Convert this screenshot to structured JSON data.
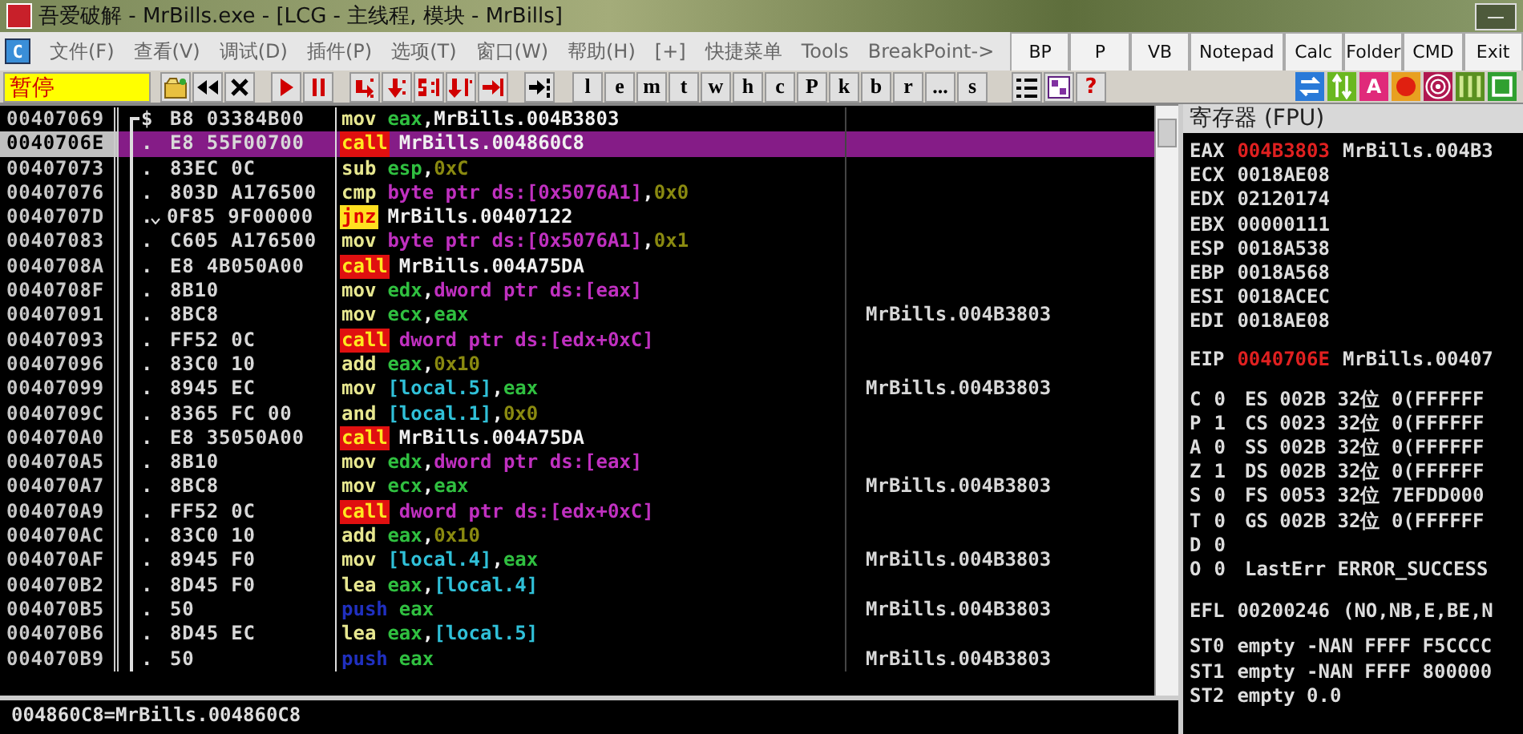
{
  "window": {
    "title": "吾爱破解 - MrBills.exe - [LCG -  主线程, 模块 - MrBills]",
    "minimize": "—"
  },
  "menu": {
    "logo": "C",
    "items": [
      "文件(F)",
      "查看(V)",
      "调试(D)",
      "插件(P)",
      "选项(T)",
      "窗口(W)",
      "帮助(H)",
      "[+]",
      "快捷菜单",
      "Tools",
      "BreakPoint->"
    ]
  },
  "plugin_buttons": [
    "BP",
    "P",
    "VB",
    "Notepad",
    "Calc",
    "Folder",
    "CMD",
    "Exit"
  ],
  "toolbar": {
    "status": "暂停",
    "letter_buttons": [
      "l",
      "e",
      "m",
      "t",
      "w",
      "h",
      "c",
      "P",
      "k",
      "b",
      "r",
      "...",
      "s"
    ],
    "help": "?",
    "badge_letter": "A"
  },
  "disassembly": {
    "rows": [
      {
        "address": "00407069",
        "marker": "$",
        "bracket_start": true,
        "jump": false,
        "hex": "B8 03384B00",
        "selected": false,
        "kind": "plain",
        "mnemonic": "mov",
        "operands": [
          {
            "text": "eax",
            "kind": "reg"
          },
          {
            "text": ",",
            "kind": "punct"
          },
          {
            "text": "MrBills.004B3803",
            "kind": "sym"
          }
        ]
      },
      {
        "address": "0040706E",
        "marker": ".",
        "bracket_start": false,
        "jump": false,
        "hex": "E8 55F00700",
        "selected": true,
        "kind": "call",
        "mnemonic": "call",
        "operands": [
          {
            "text": "MrBills.004860C8",
            "kind": "sym"
          }
        ]
      },
      {
        "address": "00407073",
        "marker": ".",
        "bracket_start": false,
        "jump": false,
        "hex": "83EC 0C",
        "selected": false,
        "kind": "plain",
        "mnemonic": "sub",
        "operands": [
          {
            "text": "esp",
            "kind": "reg"
          },
          {
            "text": ",",
            "kind": "punct"
          },
          {
            "text": "0xC",
            "kind": "num"
          }
        ]
      },
      {
        "address": "00407076",
        "marker": ".",
        "bracket_start": false,
        "jump": false,
        "hex": "803D A176500",
        "selected": false,
        "kind": "plain",
        "mnemonic": "cmp",
        "operands": [
          {
            "text": "byte ptr ds:[0x5076A1]",
            "kind": "mem"
          },
          {
            "text": ",",
            "kind": "punct"
          },
          {
            "text": "0x0",
            "kind": "num"
          }
        ]
      },
      {
        "address": "0040707D",
        "marker": ".",
        "bracket_start": false,
        "jump": true,
        "hex": "0F85 9F00000",
        "selected": false,
        "kind": "jump",
        "mnemonic": "jnz",
        "operands": [
          {
            "text": "MrBills.00407122",
            "kind": "sym"
          }
        ]
      },
      {
        "address": "00407083",
        "marker": ".",
        "bracket_start": false,
        "jump": false,
        "hex": "C605 A176500",
        "selected": false,
        "kind": "plain",
        "mnemonic": "mov",
        "operands": [
          {
            "text": "byte ptr ds:[0x5076A1]",
            "kind": "mem"
          },
          {
            "text": ",",
            "kind": "punct"
          },
          {
            "text": "0x1",
            "kind": "num"
          }
        ]
      },
      {
        "address": "0040708A",
        "marker": ".",
        "bracket_start": false,
        "jump": false,
        "hex": "E8 4B050A00",
        "selected": false,
        "kind": "call",
        "mnemonic": "call",
        "operands": [
          {
            "text": "MrBills.004A75DA",
            "kind": "sym"
          }
        ]
      },
      {
        "address": "0040708F",
        "marker": ".",
        "bracket_start": false,
        "jump": false,
        "hex": "8B10",
        "selected": false,
        "kind": "plain",
        "mnemonic": "mov",
        "operands": [
          {
            "text": "edx",
            "kind": "reg"
          },
          {
            "text": ",",
            "kind": "punct"
          },
          {
            "text": "dword ptr ds:[eax]",
            "kind": "mem"
          }
        ]
      },
      {
        "address": "00407091",
        "marker": ".",
        "bracket_start": false,
        "jump": false,
        "hex": "8BC8",
        "selected": false,
        "kind": "plain",
        "mnemonic": "mov",
        "operands": [
          {
            "text": "ecx",
            "kind": "reg"
          },
          {
            "text": ",",
            "kind": "punct"
          },
          {
            "text": "eax",
            "kind": "reg"
          }
        ],
        "comment": "MrBills.004B3803"
      },
      {
        "address": "00407093",
        "marker": ".",
        "bracket_start": false,
        "jump": false,
        "hex": "FF52 0C",
        "selected": false,
        "kind": "call",
        "mnemonic": "call",
        "operands": [
          {
            "text": "dword ptr ds:[edx+0xC]",
            "kind": "mem"
          }
        ]
      },
      {
        "address": "00407096",
        "marker": ".",
        "bracket_start": false,
        "jump": false,
        "hex": "83C0 10",
        "selected": false,
        "kind": "plain",
        "mnemonic": "add",
        "operands": [
          {
            "text": "eax",
            "kind": "reg"
          },
          {
            "text": ",",
            "kind": "punct"
          },
          {
            "text": "0x10",
            "kind": "num"
          }
        ]
      },
      {
        "address": "00407099",
        "marker": ".",
        "bracket_start": false,
        "jump": false,
        "hex": "8945 EC",
        "selected": false,
        "kind": "plain",
        "mnemonic": "mov",
        "operands": [
          {
            "text": "[local.5]",
            "kind": "local"
          },
          {
            "text": ",",
            "kind": "punct"
          },
          {
            "text": "eax",
            "kind": "reg"
          }
        ],
        "comment": "MrBills.004B3803"
      },
      {
        "address": "0040709C",
        "marker": ".",
        "bracket_start": false,
        "jump": false,
        "hex": "8365 FC 00",
        "selected": false,
        "kind": "plain",
        "mnemonic": "and",
        "operands": [
          {
            "text": "[local.1]",
            "kind": "local"
          },
          {
            "text": ",",
            "kind": "punct"
          },
          {
            "text": "0x0",
            "kind": "num"
          }
        ]
      },
      {
        "address": "004070A0",
        "marker": ".",
        "bracket_start": false,
        "jump": false,
        "hex": "E8 35050A00",
        "selected": false,
        "kind": "call",
        "mnemonic": "call",
        "operands": [
          {
            "text": "MrBills.004A75DA",
            "kind": "sym"
          }
        ]
      },
      {
        "address": "004070A5",
        "marker": ".",
        "bracket_start": false,
        "jump": false,
        "hex": "8B10",
        "selected": false,
        "kind": "plain",
        "mnemonic": "mov",
        "operands": [
          {
            "text": "edx",
            "kind": "reg"
          },
          {
            "text": ",",
            "kind": "punct"
          },
          {
            "text": "dword ptr ds:[eax]",
            "kind": "mem"
          }
        ]
      },
      {
        "address": "004070A7",
        "marker": ".",
        "bracket_start": false,
        "jump": false,
        "hex": "8BC8",
        "selected": false,
        "kind": "plain",
        "mnemonic": "mov",
        "operands": [
          {
            "text": "ecx",
            "kind": "reg"
          },
          {
            "text": ",",
            "kind": "punct"
          },
          {
            "text": "eax",
            "kind": "reg"
          }
        ],
        "comment": "MrBills.004B3803"
      },
      {
        "address": "004070A9",
        "marker": ".",
        "bracket_start": false,
        "jump": false,
        "hex": "FF52 0C",
        "selected": false,
        "kind": "call",
        "mnemonic": "call",
        "operands": [
          {
            "text": "dword ptr ds:[edx+0xC]",
            "kind": "mem"
          }
        ]
      },
      {
        "address": "004070AC",
        "marker": ".",
        "bracket_start": false,
        "jump": false,
        "hex": "83C0 10",
        "selected": false,
        "kind": "plain",
        "mnemonic": "add",
        "operands": [
          {
            "text": "eax",
            "kind": "reg"
          },
          {
            "text": ",",
            "kind": "punct"
          },
          {
            "text": "0x10",
            "kind": "num"
          }
        ]
      },
      {
        "address": "004070AF",
        "marker": ".",
        "bracket_start": false,
        "jump": false,
        "hex": "8945 F0",
        "selected": false,
        "kind": "plain",
        "mnemonic": "mov",
        "operands": [
          {
            "text": "[local.4]",
            "kind": "local"
          },
          {
            "text": ",",
            "kind": "punct"
          },
          {
            "text": "eax",
            "kind": "reg"
          }
        ],
        "comment": "MrBills.004B3803"
      },
      {
        "address": "004070B2",
        "marker": ".",
        "bracket_start": false,
        "jump": false,
        "hex": "8D45 F0",
        "selected": false,
        "kind": "plain",
        "mnemonic": "lea",
        "operands": [
          {
            "text": "eax",
            "kind": "reg"
          },
          {
            "text": ",",
            "kind": "punct"
          },
          {
            "text": "[local.4]",
            "kind": "local"
          }
        ]
      },
      {
        "address": "004070B5",
        "marker": ".",
        "bracket_start": false,
        "jump": false,
        "hex": "50",
        "selected": false,
        "kind": "push",
        "mnemonic": "push",
        "operands": [
          {
            "text": "eax",
            "kind": "reg"
          }
        ],
        "comment": "MrBills.004B3803"
      },
      {
        "address": "004070B6",
        "marker": ".",
        "bracket_start": false,
        "jump": false,
        "hex": "8D45 EC",
        "selected": false,
        "kind": "plain",
        "mnemonic": "lea",
        "operands": [
          {
            "text": "eax",
            "kind": "reg"
          },
          {
            "text": ",",
            "kind": "punct"
          },
          {
            "text": "[local.5]",
            "kind": "local"
          }
        ]
      },
      {
        "address": "004070B9",
        "marker": ".",
        "bracket_start": false,
        "jump": false,
        "hex": "50",
        "selected": false,
        "kind": "push",
        "mnemonic": "push",
        "operands": [
          {
            "text": "eax",
            "kind": "reg"
          }
        ],
        "comment": "MrBills.004B3803"
      }
    ]
  },
  "info_pane": "004860C8=MrBills.004860C8",
  "registers": {
    "title": "寄存器 (FPU)",
    "general": [
      {
        "name": "EAX",
        "value": "004B3803",
        "changed": true,
        "comment": "MrBills.004B3"
      },
      {
        "name": "ECX",
        "value": "0018AE08",
        "changed": false
      },
      {
        "name": "EDX",
        "value": "02120174",
        "changed": false
      },
      {
        "name": "EBX",
        "value": "00000111",
        "changed": false
      },
      {
        "name": "ESP",
        "value": "0018A538",
        "changed": false
      },
      {
        "name": "EBP",
        "value": "0018A568",
        "changed": false
      },
      {
        "name": "ESI",
        "value": "0018ACEC",
        "changed": false
      },
      {
        "name": "EDI",
        "value": "0018AE08",
        "changed": false
      }
    ],
    "eip": {
      "name": "EIP",
      "value": "0040706E",
      "changed": true,
      "comment": "MrBills.00407"
    },
    "flags": [
      {
        "flag": "C",
        "value": "0",
        "detail": "ES 002B 32位 0(FFFFFF"
      },
      {
        "flag": "P",
        "value": "1",
        "detail": "CS 0023 32位 0(FFFFFF"
      },
      {
        "flag": "A",
        "value": "0",
        "detail": "SS 002B 32位 0(FFFFFF"
      },
      {
        "flag": "Z",
        "value": "1",
        "detail": "DS 002B 32位 0(FFFFFF"
      },
      {
        "flag": "S",
        "value": "0",
        "detail": "FS 0053 32位 7EFDD000"
      },
      {
        "flag": "T",
        "value": "0",
        "detail": "GS 002B 32位 0(FFFFFF"
      },
      {
        "flag": "D",
        "value": "0"
      },
      {
        "flag": "O",
        "value": "0",
        "detail": "LastErr ERROR_SUCCESS"
      }
    ],
    "efl": {
      "name": "EFL",
      "value": "00200246",
      "detail": "(NO,NB,E,BE,N"
    },
    "fpu": [
      {
        "name": "ST0",
        "text": "empty -NAN FFFF F5CCCC"
      },
      {
        "name": "ST1",
        "text": "empty -NAN FFFF 800000"
      },
      {
        "name": "ST2",
        "text": "empty 0.0"
      }
    ]
  }
}
